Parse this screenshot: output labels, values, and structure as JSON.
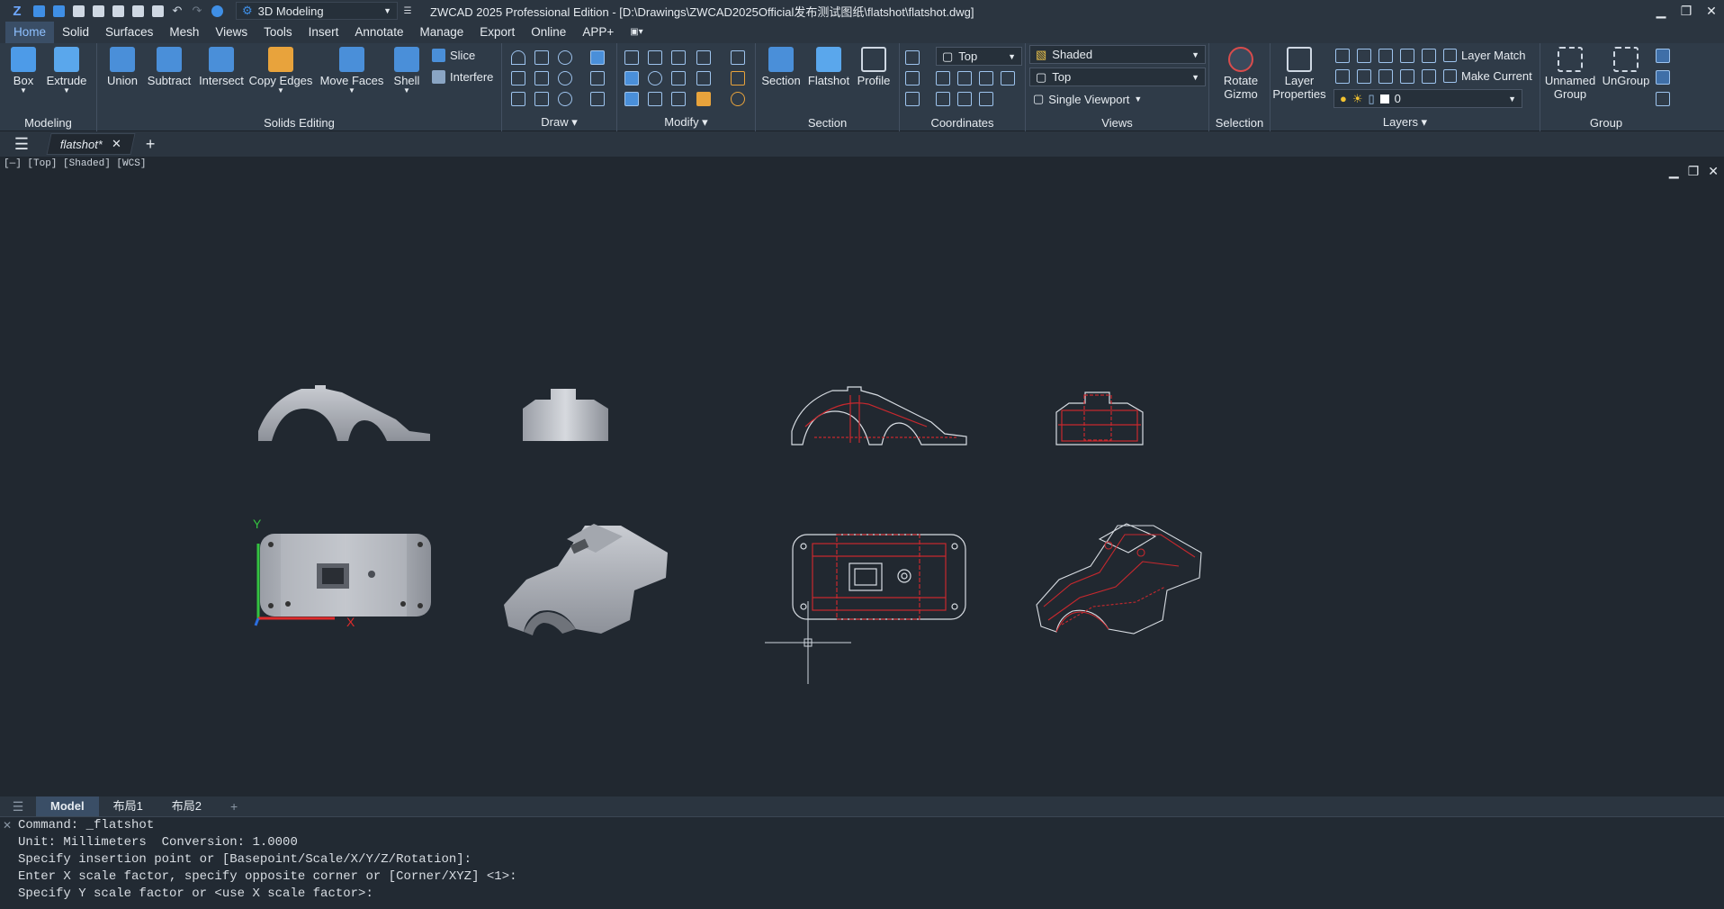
{
  "titlebar": {
    "workspace": "3D Modeling",
    "title": "ZWCAD 2025 Professional Edition - [D:\\Drawings\\ZWCAD2025Official发布测试图纸\\flatshot\\flatshot.dwg]",
    "minimize": "▁",
    "restore": "❐",
    "close": "✕"
  },
  "menu": [
    "Home",
    "Solid",
    "Surfaces",
    "Mesh",
    "Views",
    "Tools",
    "Insert",
    "Annotate",
    "Manage",
    "Export",
    "Online",
    "APP+"
  ],
  "ribbon": {
    "modeling": {
      "label": "Modeling",
      "box": "Box",
      "extrude": "Extrude"
    },
    "solids_editing": {
      "label": "Solids Editing",
      "union": "Union",
      "subtract": "Subtract",
      "intersect": "Intersect",
      "copy_edges": "Copy Edges",
      "move_faces": "Move Faces",
      "shell": "Shell",
      "slice": "Slice",
      "interfere": "Interfere"
    },
    "draw": {
      "label": "Draw ▾"
    },
    "modify": {
      "label": "Modify ▾"
    },
    "section": {
      "label": "Section",
      "section": "Section",
      "flatshot": "Flatshot",
      "profile": "Profile"
    },
    "coordinates": {
      "label": "Coordinates",
      "view_combo": "Top"
    },
    "views": {
      "label": "Views",
      "visual_style": "Shaded",
      "view": "Top",
      "viewport": "Single Viewport"
    },
    "selection": {
      "label": "Selection",
      "rotate_gizmo_1": "Rotate",
      "rotate_gizmo_2": "Gizmo"
    },
    "layers": {
      "label": "Layers ▾",
      "layer_props_1": "Layer",
      "layer_props_2": "Properties",
      "layer_match": "Layer Match",
      "make_current": "Make Current",
      "current_layer": "0"
    },
    "group": {
      "label": "Group",
      "unnamed_1": "Unnamed",
      "unnamed_2": "Group",
      "ungroup": "UnGroup"
    }
  },
  "tabs": {
    "file": "flatshot*"
  },
  "viewport": {
    "label": "[—] [Top] [Shaded] [WCS]"
  },
  "layout_tabs": [
    "Model",
    "布局1",
    "布局2"
  ],
  "command_lines": [
    "Command: _flatshot",
    "Unit: Millimeters  Conversion: 1.0000",
    "Specify insertion point or [Basepoint/Scale/X/Y/Z/Rotation]:",
    "Enter X scale factor, specify opposite corner or [Corner/XYZ] <1>:",
    "Specify Y scale factor or <use X scale factor>:"
  ],
  "colors": {
    "accent": "#3f8fe6",
    "viewport_bg": "#212830",
    "flatshot_red": "#c8282e",
    "solid_gray": "#a9adb4"
  }
}
